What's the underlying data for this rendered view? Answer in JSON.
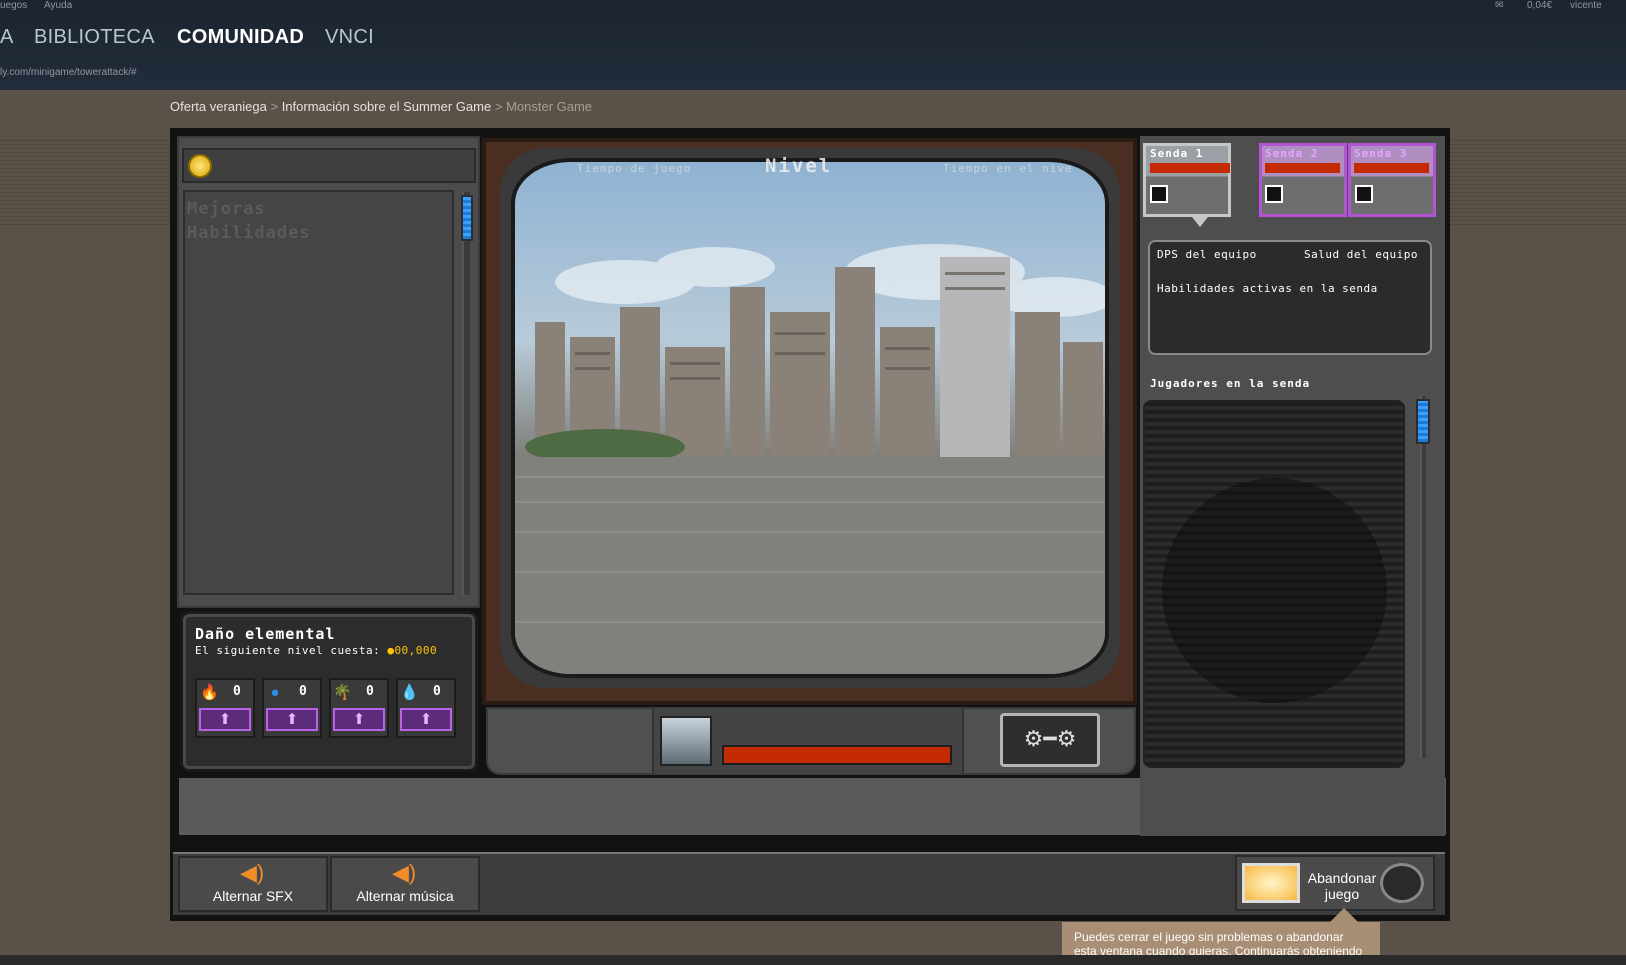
{
  "topbar": {
    "mini_links": [
      "uegos",
      "Ayuda"
    ],
    "wallet": "0,04€",
    "username": "vicente",
    "nav": [
      "A",
      "BIBLIOTECA",
      "COMUNIDAD",
      "VNCI"
    ],
    "url": "ly.com/minigame/towerattack/#"
  },
  "breadcrumb": [
    "Oferta veraniega",
    "Información sobre el Summer Game",
    "Monster Game"
  ],
  "left_panel": {
    "tabs": [
      "Mejoras",
      "Habilidades"
    ],
    "element_title": "Daño elemental",
    "element_cost_label": "El siguiente nivel cuesta:",
    "element_cost_value": "00,000",
    "elements": [
      {
        "icon": "fire-icon",
        "glyph": "🔥",
        "count": "0"
      },
      {
        "icon": "water-icon",
        "glyph": "●",
        "count": "0"
      },
      {
        "icon": "earth-icon",
        "glyph": "🌴",
        "count": "0"
      },
      {
        "icon": "air-icon",
        "glyph": "💧",
        "count": "0"
      }
    ]
  },
  "tv": {
    "hud_left": "Tiempo de juego",
    "hud_center": "Nivel",
    "hud_right": "Tiempo en el nivel"
  },
  "right_panel": {
    "lanes": [
      "Senda 1",
      "Senda 2",
      "Senda 3"
    ],
    "dps_label": "DPS del equipo",
    "health_label": "Salud del equipo",
    "abilities_label": "Habilidades activas en la senda",
    "players_label": "Jugadores en la senda"
  },
  "bottom": {
    "sfx_label": "Alternar SFX",
    "music_label": "Alternar música",
    "abandon_label": "Abandonar juego",
    "tooltip": "Puedes cerrar el juego sin problemas o abandonar esta ventana cuando quieras. Continuarás obteniendo"
  },
  "colors": {
    "accent_blue": "#3aa0ff",
    "lane_purple": "#b353d6",
    "health_red": "#c42a04",
    "gold": "#ffc400"
  }
}
